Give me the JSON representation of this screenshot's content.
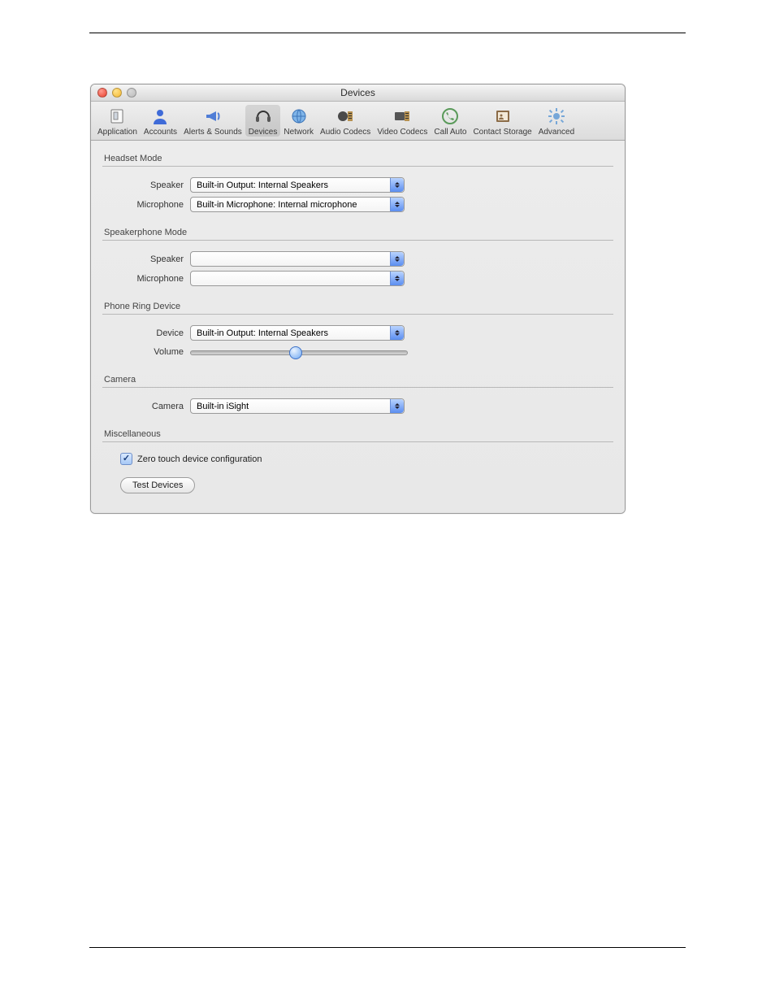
{
  "window": {
    "title": "Devices"
  },
  "toolbar": {
    "items": [
      {
        "name": "application",
        "label": "Application"
      },
      {
        "name": "accounts",
        "label": "Accounts"
      },
      {
        "name": "alerts-sounds",
        "label": "Alerts & Sounds"
      },
      {
        "name": "devices",
        "label": "Devices"
      },
      {
        "name": "network",
        "label": "Network"
      },
      {
        "name": "audio-codecs",
        "label": "Audio Codecs"
      },
      {
        "name": "video-codecs",
        "label": "Video Codecs"
      },
      {
        "name": "call-auto",
        "label": "Call Auto"
      },
      {
        "name": "contact-storage",
        "label": "Contact Storage"
      },
      {
        "name": "advanced",
        "label": "Advanced"
      }
    ],
    "selected": "devices"
  },
  "sections": {
    "headset": {
      "title": "Headset Mode",
      "speaker_label": "Speaker",
      "speaker_value": "Built-in Output: Internal Speakers",
      "mic_label": "Microphone",
      "mic_value": "Built-in Microphone: Internal microphone"
    },
    "speakerphone": {
      "title": "Speakerphone Mode",
      "speaker_label": "Speaker",
      "speaker_value": "",
      "mic_label": "Microphone",
      "mic_value": ""
    },
    "ring": {
      "title": "Phone Ring Device",
      "device_label": "Device",
      "device_value": "Built-in Output: Internal Speakers",
      "volume_label": "Volume",
      "volume_percent": 48
    },
    "camera": {
      "title": "Camera",
      "camera_label": "Camera",
      "camera_value": "Built-in iSight"
    },
    "misc": {
      "title": "Miscellaneous",
      "zero_touch_label": "Zero touch device configuration",
      "zero_touch_checked": true,
      "test_button": "Test Devices"
    }
  }
}
